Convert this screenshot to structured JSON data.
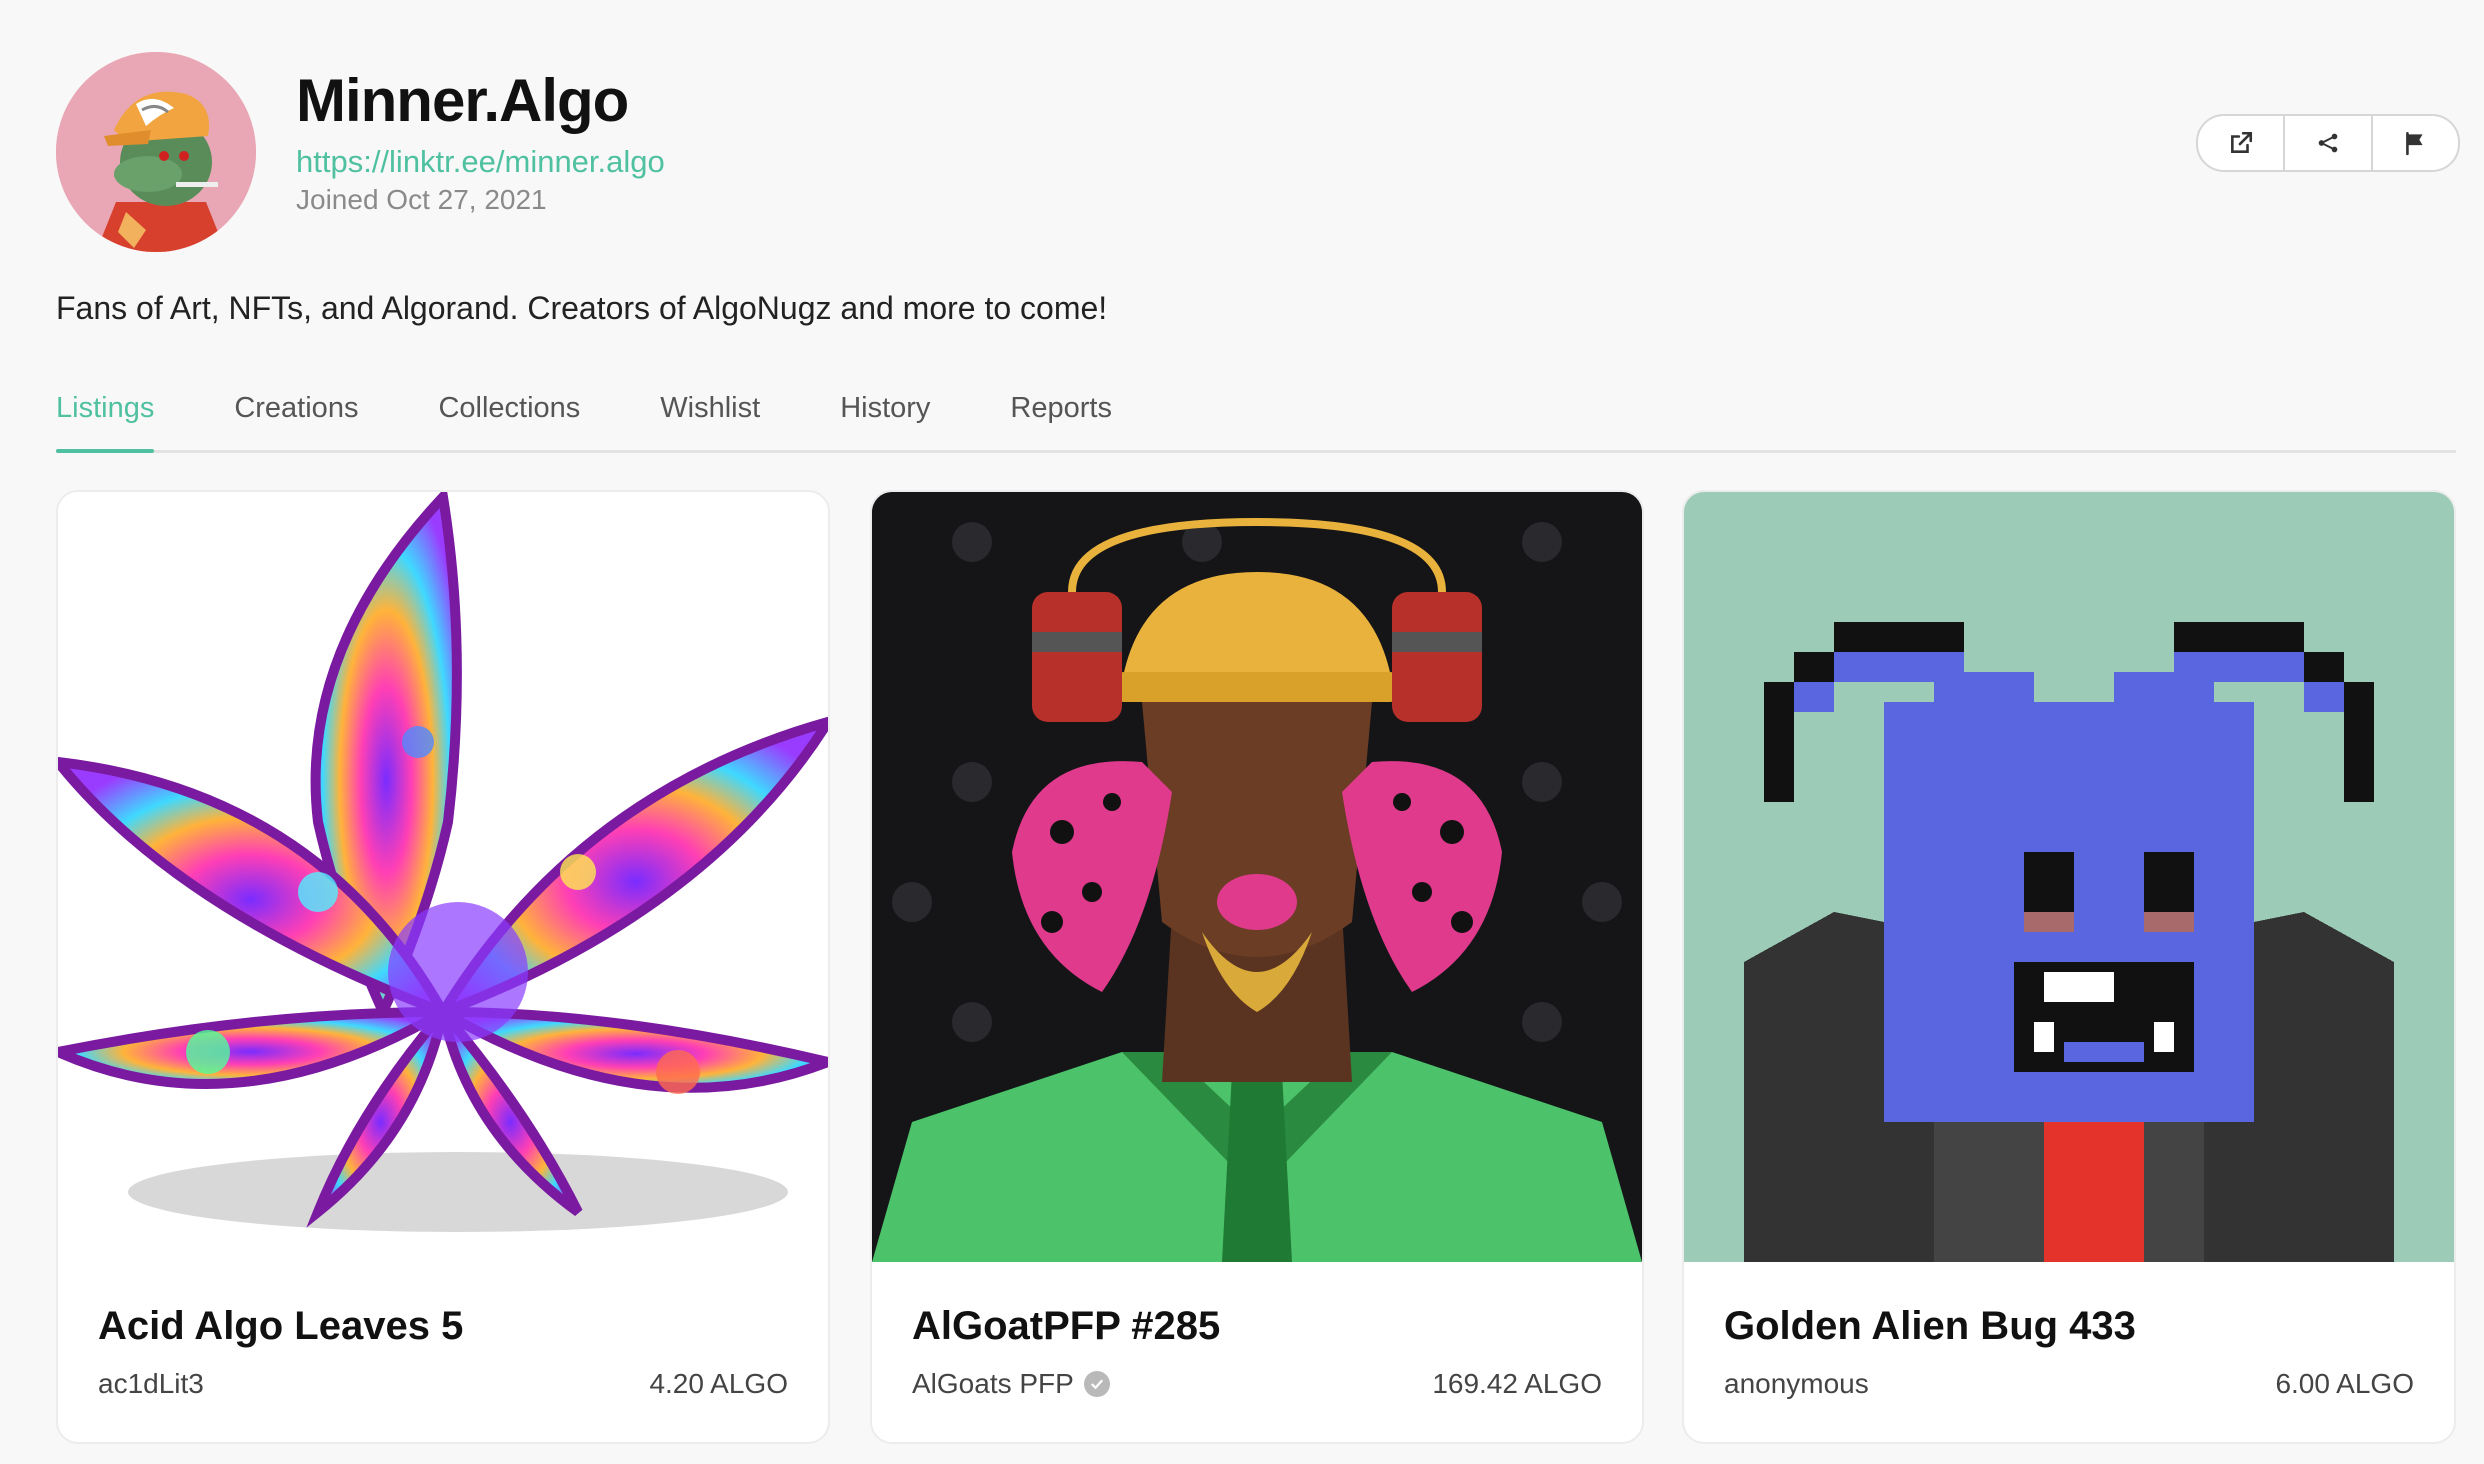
{
  "profile": {
    "name": "Minner.Algo",
    "link": "https://linktr.ee/minner.algo",
    "joined": "Joined Oct 27, 2021",
    "bio": "Fans of Art, NFTs, and Algorand. Creators of AlgoNugz and more to come!",
    "avatar_icon": "algo-lizard-avatar"
  },
  "actions": [
    {
      "icon": "external-link-icon"
    },
    {
      "icon": "share-icon"
    },
    {
      "icon": "flag-icon"
    }
  ],
  "tabs": [
    {
      "label": "Listings",
      "active": true
    },
    {
      "label": "Creations"
    },
    {
      "label": "Collections"
    },
    {
      "label": "Wishlist"
    },
    {
      "label": "History"
    },
    {
      "label": "Reports"
    }
  ],
  "listings": [
    {
      "title": "Acid Algo Leaves 5",
      "creator": "ac1dLit3",
      "price": "4.20 ALGO",
      "verified": false
    },
    {
      "title": "AlGoatPFP #285",
      "creator": "AlGoats PFP",
      "price": "169.42 ALGO",
      "verified": true
    },
    {
      "title": "Golden Alien Bug 433",
      "creator": "anonymous",
      "price": "6.00 ALGO",
      "verified": false
    }
  ],
  "colors": {
    "accent": "#4fc1a0",
    "background": "#f8f8f8",
    "avatar_bg": "#e9a7b5",
    "card3_bg": "#9cccb7"
  }
}
